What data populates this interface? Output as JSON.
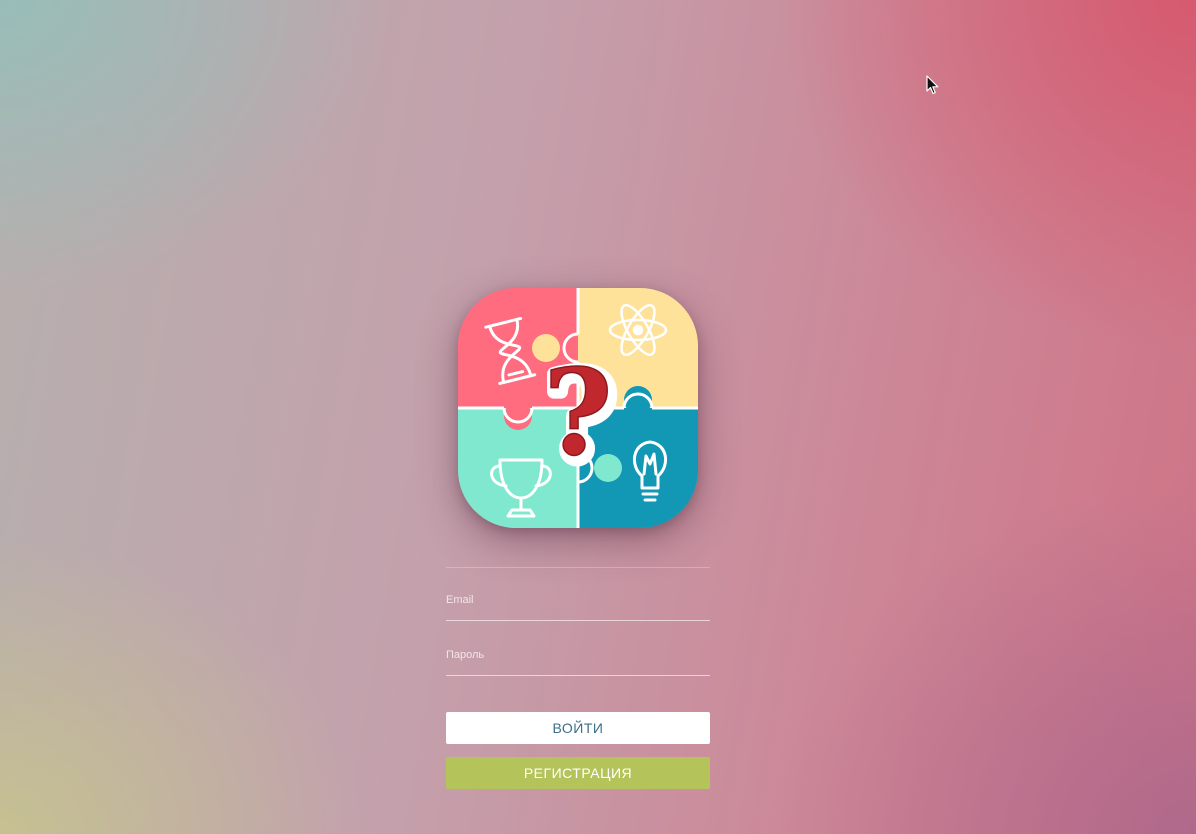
{
  "colors": {
    "login_button_bg": "#ffffff",
    "login_button_text": "#3d6f8a",
    "register_button_bg": "#b5c45a",
    "register_button_text": "#ffffff",
    "puzzle_pink": "#ff6b7f",
    "puzzle_yellow": "#ffe29a",
    "puzzle_mint": "#7fe8cf",
    "puzzle_teal": "#1297b4",
    "question_mark": "#c0282e"
  },
  "logo": {
    "icon": "puzzle-question-icon",
    "pieces": [
      "hourglass-icon",
      "atom-icon",
      "trophy-icon",
      "lightbulb-icon"
    ]
  },
  "form": {
    "email": {
      "placeholder": "Email",
      "value": ""
    },
    "password": {
      "placeholder": "Пароль",
      "value": ""
    }
  },
  "buttons": {
    "login_label": "ВОЙТИ",
    "register_label": "РЕГИСТРАЦИЯ"
  }
}
